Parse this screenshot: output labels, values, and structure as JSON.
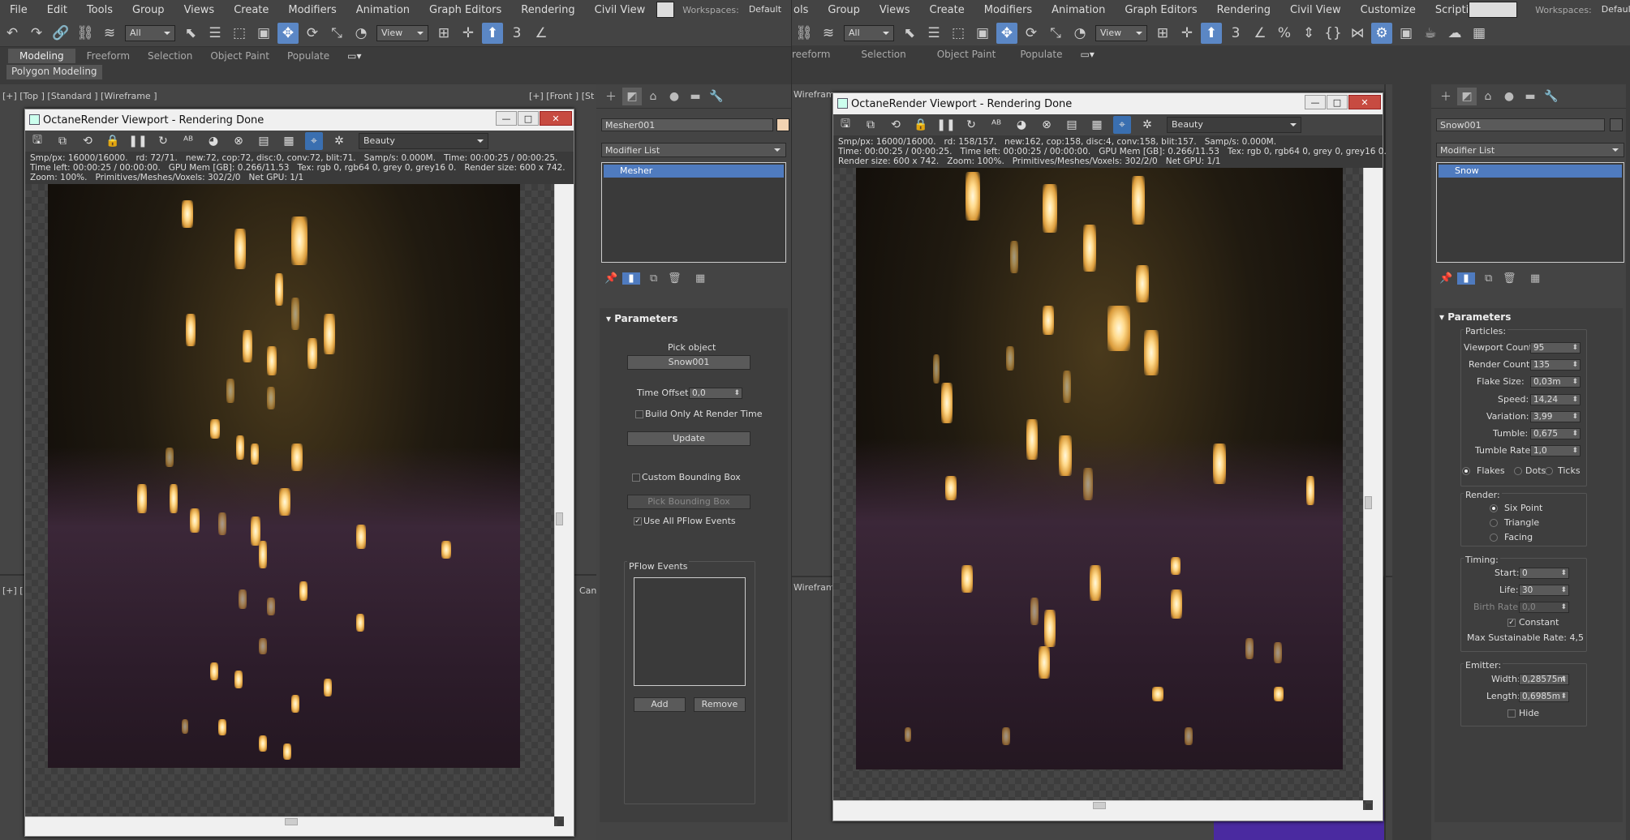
{
  "left": {
    "menu": [
      "File",
      "Edit",
      "Tools",
      "Group",
      "Views",
      "Create",
      "Modifiers",
      "Animation",
      "Graph Editors",
      "Rendering",
      "Civil View"
    ],
    "workspaces_label": "Workspaces:",
    "workspaces_value": "Default",
    "selection_filter": "All",
    "ref_coord": "View",
    "ribbon_tabs": [
      "Modeling",
      "Freeform",
      "Selection",
      "Object Paint",
      "Populate"
    ],
    "ribbon_sub": "Polygon Modeling",
    "viewport_label_top": "[+] [Top ] [Standard ] [Wireframe ]",
    "viewport_label_front": "[+] [Front ] [St",
    "viewport_label_mini": "[+] [",
    "viewport_label_can": "Can",
    "vfb": {
      "title": "OctaneRender Viewport - Rendering Done",
      "pass": "Beauty",
      "stats_line1": "Smp/px: 16000/16000.   rd: 72/71.   new:72, cop:72, disc:0, conv:72, blit:71.   Samp/s: 0.000M.   Time: 00:00:25 / 00:00:25.",
      "stats_line2": "Time left: 00:00:25 / 00:00:00.   GPU Mem [GB]: 0.266/11.53   Tex: rgb 0, rgb64 0, grey 0, grey16 0.   Render size: 600 x 742.",
      "stats_line3": "Zoom: 100%.   Primitives/Meshes/Voxels: 302/2/0   Net GPU: 1/1"
    },
    "panel": {
      "object_name": "Mesher001",
      "object_color": "#f2d3b2",
      "modifier_list": "Modifier List",
      "stack_item": "Mesher",
      "rollout": "Parameters",
      "pick_object_label": "Pick object",
      "pick_object_value": "Snow001",
      "time_offset_label": "Time Offset:",
      "time_offset_value": "0,0",
      "build_only": "Build Only At Render Time",
      "update": "Update",
      "custom_bbox": "Custom Bounding Box",
      "pick_bbox": "Pick Bounding Box",
      "use_all_pflow": "Use All PFlow Events",
      "pflow_events": "PFlow Events",
      "add": "Add",
      "remove": "Remove"
    }
  },
  "right": {
    "menu": [
      "ols",
      "Group",
      "Views",
      "Create",
      "Modifiers",
      "Animation",
      "Graph Editors",
      "Rendering",
      "Civil View",
      "Customize",
      "Scripti"
    ],
    "workspaces_label": "Workspaces:",
    "workspaces_value": "Default",
    "selection_filter": "All",
    "ref_coord": "View",
    "ribbon_tabs": [
      "reeform",
      "Selection",
      "Object Paint",
      "Populate"
    ],
    "viewport_label_top": "Wireframe",
    "viewport_label_mid": "Wireframe",
    "vfb": {
      "title": "OctaneRender Viewport - Rendering Done",
      "pass": "Beauty",
      "stats_line1": "Smp/px: 16000/16000.   rd: 158/157.   new:162, cop:158, disc:4, conv:158, blit:157.   Samp/s: 0.000M.",
      "stats_line2": "Time: 00:00:25 / 00:00:25.   Time left: 00:00:25 / 00:00:00.   GPU Mem [GB]: 0.266/11.53   Tex: rgb 0, rgb64 0, grey 0, grey16 0.",
      "stats_line3": "Render size: 600 x 742.   Zoom: 100%.   Primitives/Meshes/Voxels: 302/2/0   Net GPU: 1/1"
    },
    "panel": {
      "object_name": "Snow001",
      "object_color": "#555555",
      "modifier_list": "Modifier List",
      "stack_item": "Snow",
      "rollout": "Parameters",
      "particles_label": "Particles:",
      "params": [
        {
          "label": "Viewport Count:",
          "value": "95"
        },
        {
          "label": "Render Count:",
          "value": "135"
        },
        {
          "label": "Flake Size:",
          "value": "0,03m"
        },
        {
          "label": "Speed:",
          "value": "14,24"
        },
        {
          "label": "Variation:",
          "value": "3,99"
        },
        {
          "label": "Tumble:",
          "value": "0,675"
        },
        {
          "label": "Tumble Rate:",
          "value": "1,0"
        }
      ],
      "flakes": "Flakes",
      "dots": "Dots",
      "ticks": "Ticks",
      "render_label": "Render:",
      "six_point": "Six Point",
      "triangle": "Triangle",
      "facing": "Facing",
      "timing_label": "Timing:",
      "start_label": "Start:",
      "start_value": "0",
      "life_label": "Life:",
      "life_value": "30",
      "birth_label": "Birth Rate:",
      "birth_value": "0,0",
      "constant": "Constant",
      "max_rate": "Max Sustainable Rate: 4,5",
      "emitter_label": "Emitter:",
      "width_label": "Width:",
      "width_value": "0,28575m",
      "length_label": "Length:",
      "length_value": "0,6985m",
      "hide": "Hide"
    }
  }
}
